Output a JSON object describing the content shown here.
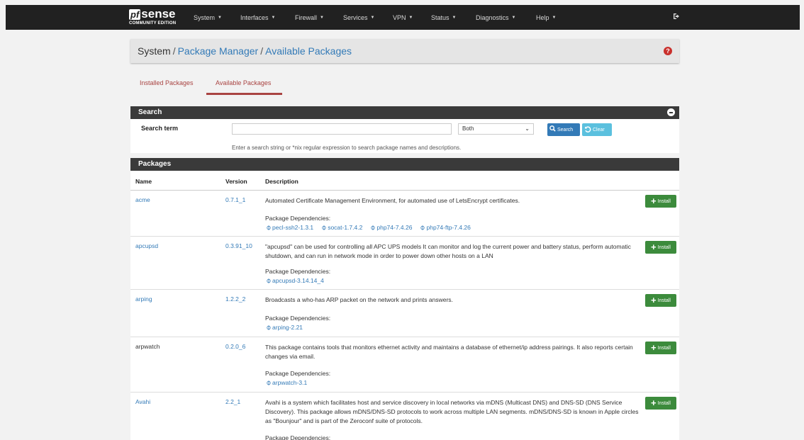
{
  "nav": {
    "brand_logo": "pf",
    "brand_name": "sense",
    "brand_edition": "COMMUNITY EDITION",
    "menus": [
      "System",
      "Interfaces",
      "Firewall",
      "Services",
      "VPN",
      "Status",
      "Diagnostics",
      "Help"
    ]
  },
  "breadcrumb": {
    "root": "System",
    "level2": "Package Manager",
    "level3": "Available Packages",
    "separator": "/"
  },
  "tabs": {
    "installed": "Installed Packages",
    "available": "Available Packages"
  },
  "search": {
    "title": "Search",
    "label": "Search term",
    "value": "",
    "select_value": "Both",
    "search_button": "Search",
    "clear_button": "Clear",
    "help": "Enter a search string or *nix regular expression to search package names and descriptions."
  },
  "packages": {
    "title": "Packages",
    "headers": {
      "name": "Name",
      "version": "Version",
      "description": "Description"
    },
    "deps_label": "Package Dependencies:",
    "install_label": "Install",
    "rows": [
      {
        "name": "acme",
        "version": "0.7.1_1",
        "description": "Automated Certificate Management Environment, for automated use of LetsEncrypt certificates.",
        "deps": [
          "pecl-ssh2-1.3.1",
          "socat-1.7.4.2",
          "php74-7.4.26",
          "php74-ftp-7.4.26"
        ]
      },
      {
        "name": "apcupsd",
        "version": "0.3.91_10",
        "description": "\"apcupsd\" can be used for controlling all APC UPS models It can monitor and log the current power and battery status, perform automatic shutdown, and can run in network mode in order to power down other hosts on a LAN",
        "deps": [
          "apcupsd-3.14.14_4"
        ]
      },
      {
        "name": "arping",
        "version": "1.2.2_2",
        "description": "Broadcasts a who-has ARP packet on the network and prints answers.",
        "deps": [
          "arping-2.21"
        ]
      },
      {
        "name": "arpwatch",
        "version": "0.2.0_6",
        "description": "This package contains tools that monitors ethernet activity and maintains a database of ethernet/ip address pairings. It also reports certain changes via email.",
        "deps": [
          "arpwatch-3.1"
        ]
      },
      {
        "name": "Avahi",
        "version": "2.2_1",
        "description": "Avahi is a system which facilitates host and service discovery in local networks via mDNS (Multicast DNS) and DNS-SD (DNS Service Discovery). This package allows mDNS/DNS-SD protocols to work across multiple LAN segments. mDNS/DNS-SD is known in Apple circles as \"Bounjour\" and is part of the Zeroconf suite of protocols.",
        "deps": []
      }
    ]
  }
}
